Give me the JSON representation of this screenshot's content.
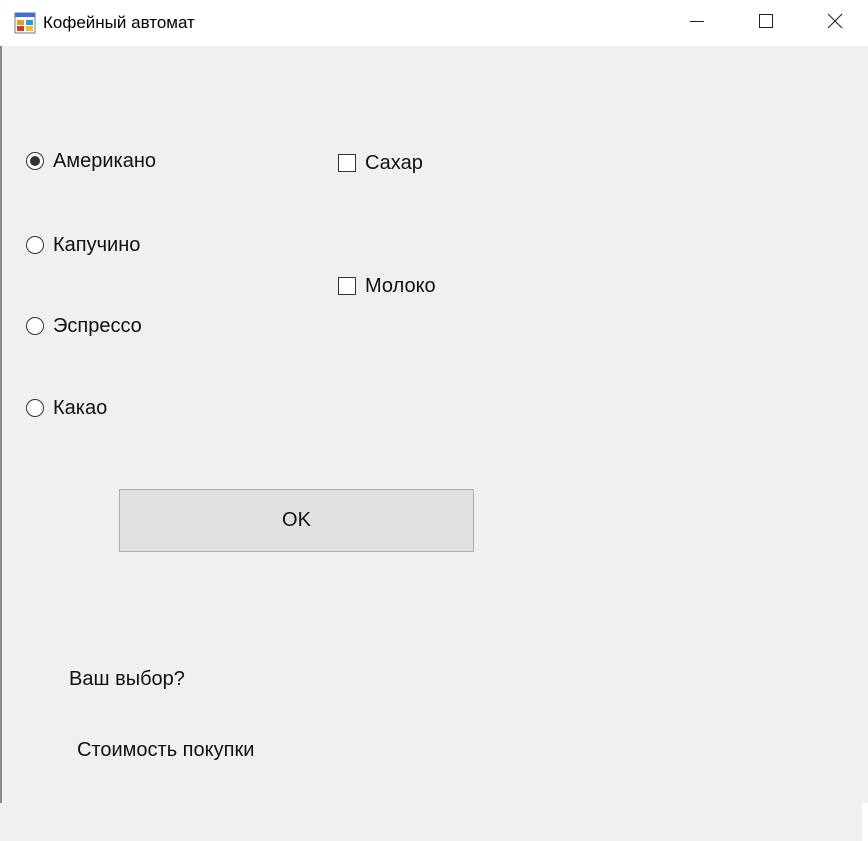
{
  "window": {
    "title": "Кофейный автомат"
  },
  "titlebar_buttons": {
    "minimize_icon": "minimize-icon",
    "maximize_icon": "maximize-icon",
    "close_icon": "close-icon"
  },
  "drinks": [
    {
      "label": "Американо",
      "selected": true
    },
    {
      "label": "Капучино",
      "selected": false
    },
    {
      "label": "Эспрессо",
      "selected": false
    },
    {
      "label": "Какао",
      "selected": false
    }
  ],
  "additions": [
    {
      "label": "Сахар",
      "checked": false
    },
    {
      "label": "Молоко",
      "checked": false
    }
  ],
  "ok_button": {
    "label": "OK"
  },
  "result": {
    "choice_text": "Ваш выбор?",
    "cost_text": "Стоимость покупки"
  }
}
